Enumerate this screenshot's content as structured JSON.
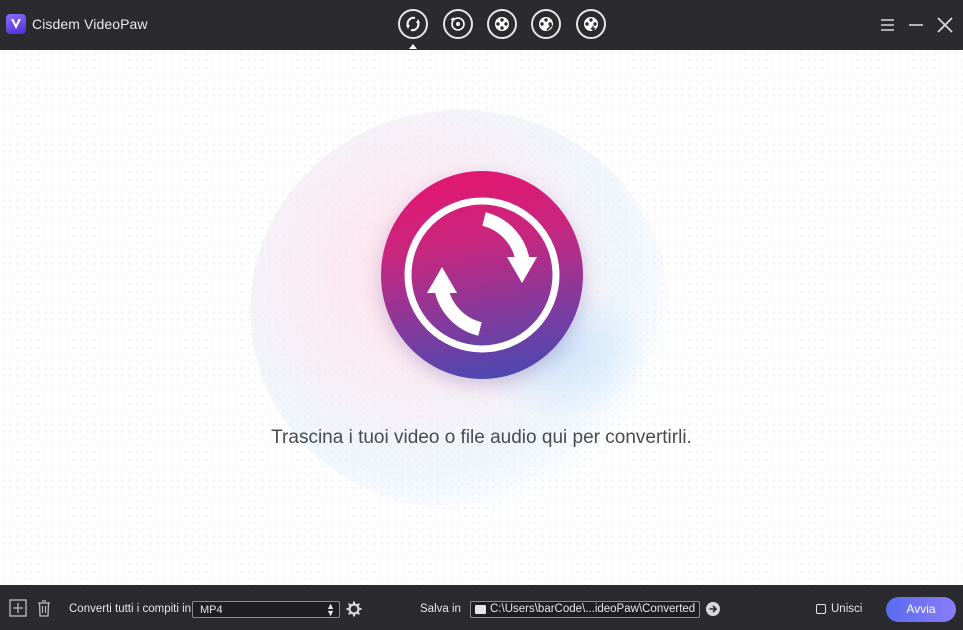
{
  "window": {
    "title": "Cisdem VideoPaw"
  },
  "header": {
    "tabs": [
      {
        "name": "converter",
        "icon": "convert-icon",
        "active": true
      },
      {
        "name": "dvd-converter",
        "icon": "disc-convert-icon",
        "active": false
      },
      {
        "name": "video-tool",
        "icon": "film-reel-icon",
        "active": false
      },
      {
        "name": "video-tool-2",
        "icon": "film-reel-edit-icon",
        "active": false
      },
      {
        "name": "video-tool-3",
        "icon": "film-reel-download-icon",
        "active": false
      }
    ],
    "controls": [
      "menu-icon",
      "minimize-icon",
      "close-icon"
    ]
  },
  "main": {
    "drop_text": "Trascina i tuoi video o file audio qui per convertirli.",
    "center_icon": "convert-icon"
  },
  "footer": {
    "add_icon": "add-icon",
    "delete_icon": "trash-icon",
    "convert_all_label": "Converti tutti i compiti in",
    "format_value": "MP4",
    "settings_icon": "gear-icon",
    "save_label": "Salva in",
    "save_path": "C:\\Users\\barCode\\...ideoPaw\\Converted",
    "open_folder_icon": "arrow-right-circle-icon",
    "merge_label": "Unisci",
    "merge_checked": false,
    "start_label": "Avvia"
  },
  "colors": {
    "titlebar": "#2b2b2f",
    "accent_start": "#5a6cf0",
    "accent_end": "#8a7cf6",
    "circle_pink": "#e8136f",
    "circle_blue": "#3f4bb5"
  }
}
